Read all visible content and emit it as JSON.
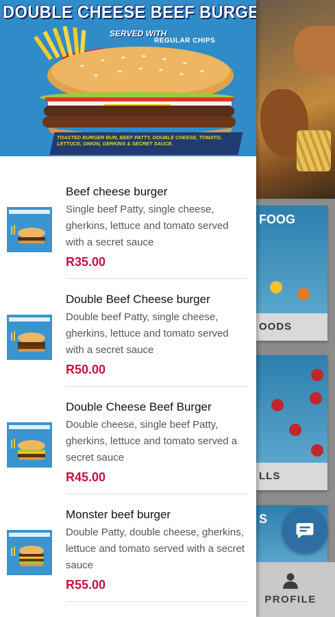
{
  "banner": {
    "title": "DOUBLE CHEESE BEEF BURGER",
    "served_with": "SERVED WITH",
    "chips": "REGULAR CHIPS",
    "caption": "Toasted burger bun, beef patty, double cheese, tomato, lettuce, onion, gerkins & secret sauce."
  },
  "menu_items": [
    {
      "name": "Beef cheese burger",
      "description": "Single beef Patty, single cheese, gherkins, lettuce and tomato served with a secret sauce",
      "price": "R35.00"
    },
    {
      "name": "Double Beef Cheese burger",
      "description": "Double beef Patty, single cheese, gherkins, lettuce and tomato served with a secret sauce",
      "price": "R50.00"
    },
    {
      "name": "Double Cheese Beef Burger",
      "description": "Double cheese, single beef Patty, gherkins, lettuce and tomato served a secret sauce",
      "price": "R45.00"
    },
    {
      "name": "Monster beef burger",
      "description": "Double Patty, double cheese, gherkins, lettuce and tomato served with a secret sauce",
      "price": "R55.00"
    }
  ],
  "background_cards": {
    "card1_heading": "FOOG",
    "card1_label": "OODS",
    "card2_label": "LLS",
    "card3_heading": "S"
  },
  "bottom_nav": {
    "profile_label": "PROFILE"
  },
  "colors": {
    "price": "#c8123e",
    "banner_blue": "#2f8cc9",
    "fab_blue": "#2e6fa3"
  },
  "icons": {
    "chat": "chat-bubble-icon",
    "profile": "person-icon"
  }
}
